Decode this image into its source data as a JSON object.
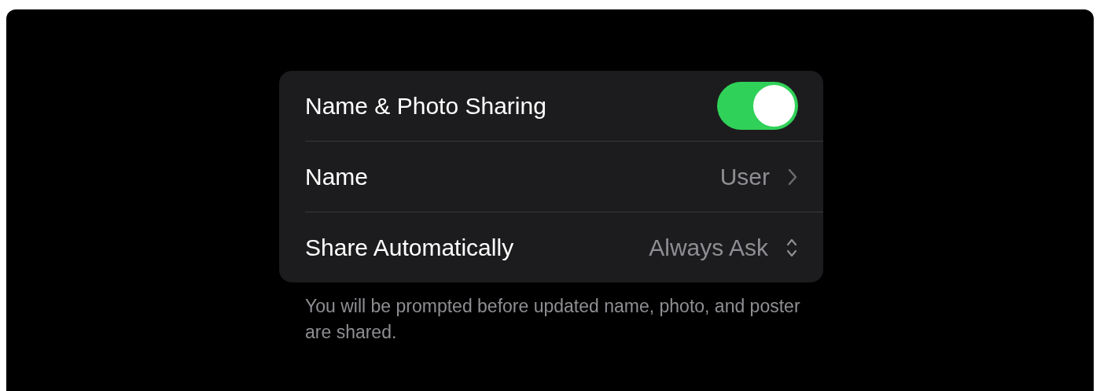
{
  "rows": [
    {
      "kind": "toggle",
      "label": "Name & Photo Sharing",
      "on": true
    },
    {
      "kind": "link",
      "label": "Name",
      "value": "User"
    },
    {
      "kind": "menu",
      "label": "Share Automatically",
      "value": "Always Ask"
    }
  ],
  "footer": "You will be prompted before updated name, photo, and poster are shared."
}
